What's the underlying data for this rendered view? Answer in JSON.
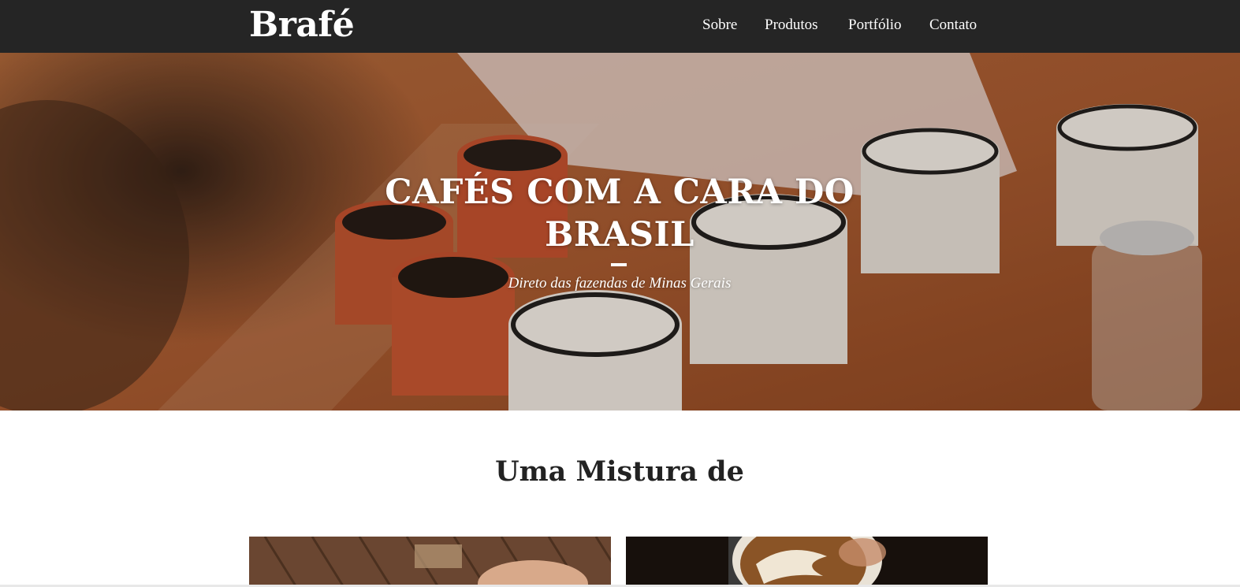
{
  "header": {
    "logo": "Brafé",
    "nav": [
      {
        "label": "Sobre"
      },
      {
        "label": "Produtos"
      },
      {
        "label": "Portfólio"
      },
      {
        "label": "Contato"
      }
    ]
  },
  "hero": {
    "title": "CAFÉS COM A CARA DO BRASIL",
    "subtitle": "Direto das fazendas de Minas Gerais"
  },
  "section": {
    "title": "Uma Mistura de"
  },
  "colors": {
    "header_bg": "#252525",
    "text_dark": "#222222",
    "text_light": "#ffffff"
  }
}
